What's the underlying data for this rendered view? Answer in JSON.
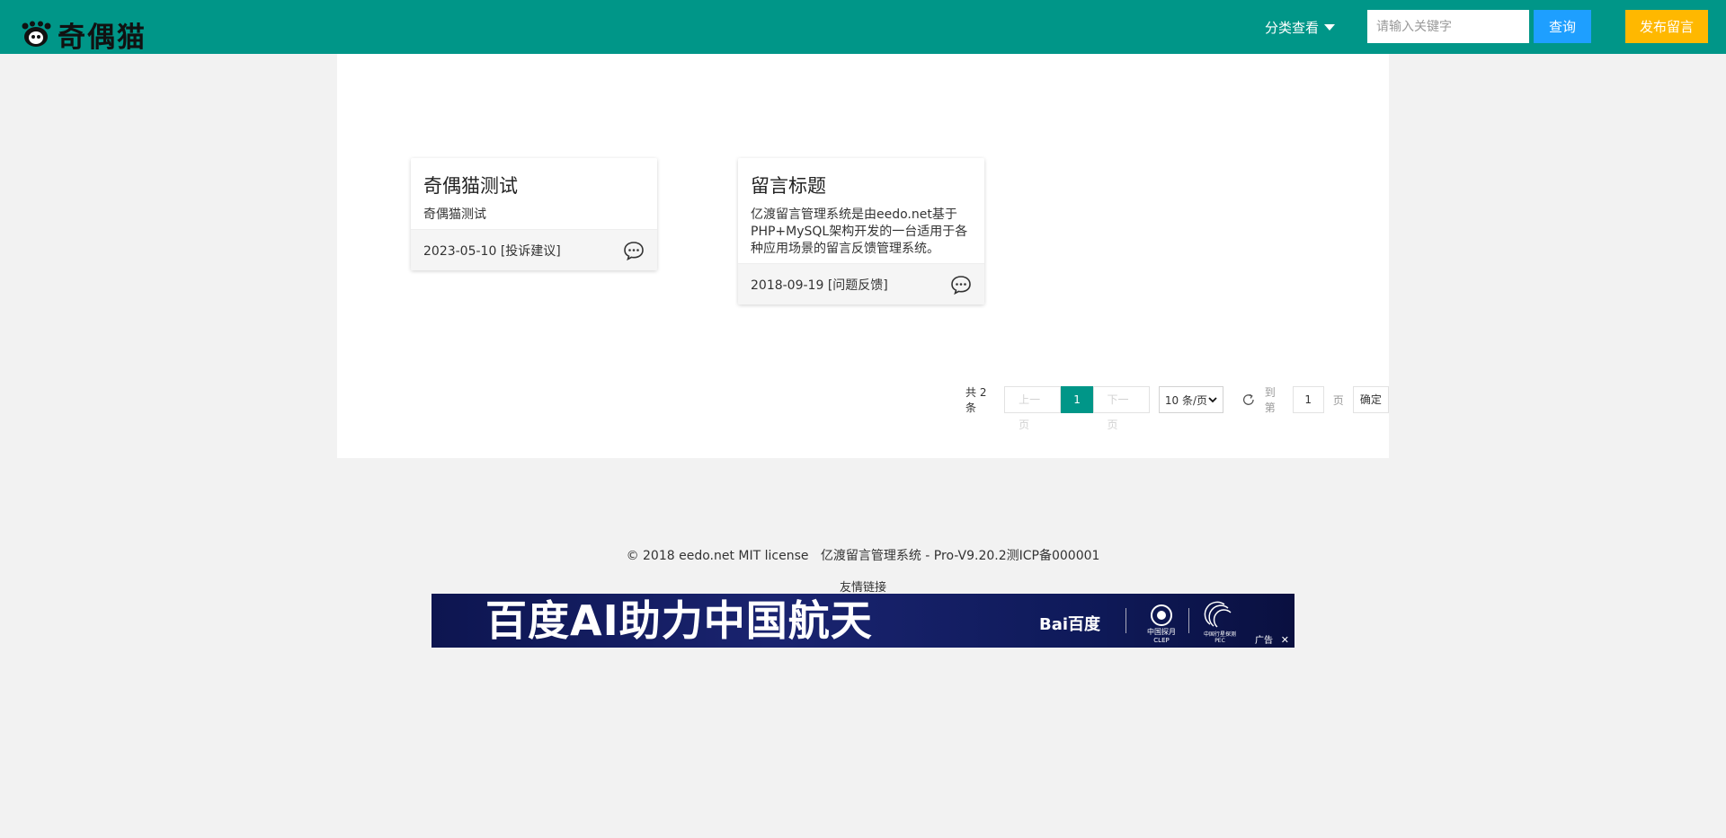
{
  "header": {
    "logo_text": "奇偶猫",
    "category_menu": "分类查看",
    "search_placeholder": "请输入关键字",
    "search_button": "查询",
    "publish_button": "发布留言",
    "colors": {
      "bar": "#009688",
      "search_button": "#1e9fff",
      "publish_button": "#ffb800"
    }
  },
  "cards": [
    {
      "title": "奇偶猫测试",
      "content": "奇偶猫测试",
      "date": "2023-05-10",
      "category": "[投诉建议]"
    },
    {
      "title": "留言标题",
      "content": "亿渡留言管理系统是由eedo.net基于PHP+MySQL架构开发的一台适用于各种应用场景的留言反馈管理系统。",
      "date": "2018-09-19",
      "category": "[问题反馈]"
    }
  ],
  "pagination": {
    "total": "共 2 条",
    "prev": "上一页",
    "current": "1",
    "next": "下一页",
    "per_page": "10 条/页",
    "goto_label": "到第",
    "page_input": "1",
    "page_suffix": "页",
    "confirm": "确定"
  },
  "footer": {
    "copyright": "© 2018 eedo.net MIT license",
    "system": "亿渡留言管理系统 - Pro-V9.20.2",
    "icp": "测ICP备000001",
    "friend_links": "友情链接"
  },
  "ad": {
    "headline": "百度AI助力中国航天",
    "brand": "Bai百度",
    "clep_label": "中国探月",
    "clep_sub": "CLEP",
    "pec_label": "中国行星探测",
    "pec_sub": "PEC",
    "tag": "广告",
    "close": "✕"
  }
}
